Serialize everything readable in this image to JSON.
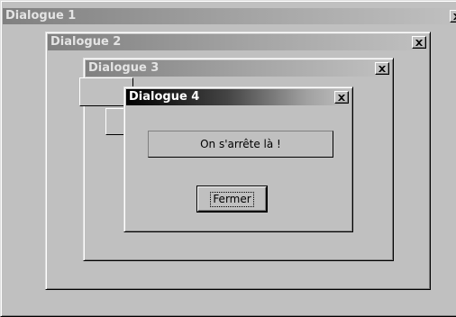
{
  "dialogs": [
    {
      "title": "Dialogue 1",
      "close_icon": "close-x-icon",
      "active": false
    },
    {
      "title": "Dialogue 2",
      "close_icon": "close-x-icon",
      "active": false
    },
    {
      "title": "Dialogue 3",
      "close_icon": "close-x-icon",
      "active": false
    },
    {
      "title": "Dialogue 4",
      "close_icon": "close-x-icon",
      "active": true,
      "message": "On s'arrête là !",
      "button_label": "Fermer"
    }
  ],
  "colors": {
    "face": "#c0c0c0",
    "inactive_title_start": "#808080",
    "active_title_start": "#000000",
    "title_text_active": "#ffffff",
    "title_text_inactive": "#e4e4e4"
  }
}
